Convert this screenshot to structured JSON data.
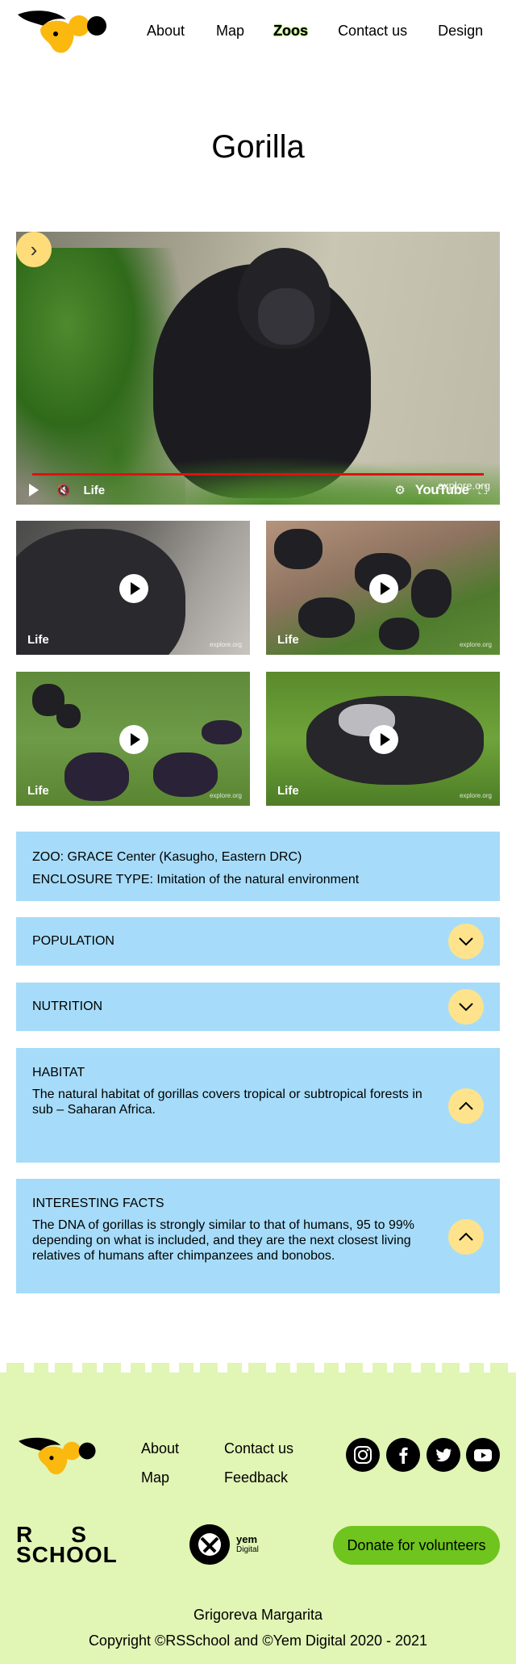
{
  "header": {
    "nav": [
      "About",
      "Map",
      "Zoos",
      "Contact us",
      "Design"
    ],
    "active_nav": "Zoos"
  },
  "page_title": "Gorilla",
  "main_video": {
    "channel_label": "Life",
    "player_brand": "YouTube",
    "watermark": "explore.org"
  },
  "thumbnails": [
    {
      "label": "Life",
      "watermark": "explore.org"
    },
    {
      "label": "Life",
      "watermark": "explore.org"
    },
    {
      "label": "Life",
      "watermark": "explore.org"
    },
    {
      "label": "Life",
      "watermark": "explore.org"
    }
  ],
  "zoo_info": {
    "zoo": "ZOO: GRACE Center (Kasugho, Eastern DRC)",
    "enclosure": "ENCLOSURE TYPE: Imitation of the natural environment"
  },
  "accordion": [
    {
      "title": "POPULATION",
      "body": "",
      "expanded": false
    },
    {
      "title": "NUTRITION",
      "body": "",
      "expanded": false
    },
    {
      "title": "HABITAT",
      "body": "The natural habitat of gorillas covers tropical or subtropical forests in sub – Saharan Africa.",
      "expanded": true
    },
    {
      "title": "INTERESTING FACTS",
      "body": "The DNA of gorillas is strongly similar to that of humans, 95 to 99% depending on what is included, and they are the next closest living relatives of humans after chimpanzees and bonobos.",
      "expanded": true
    }
  ],
  "footer": {
    "links": {
      "about": "About",
      "map": "Map",
      "contact": "Contact us",
      "feedback": "Feedback"
    },
    "social_icons": [
      "instagram-icon",
      "facebook-icon",
      "twitter-icon",
      "youtube-icon"
    ],
    "rs_line1": "RS",
    "rs_line2": "SCHOOL",
    "yem_name": "yem",
    "yem_sub": "Digital",
    "donate_label": "Donate for volunteers",
    "author": "Grigoreva Margarita",
    "copyright": "Copyright ©RSSchool and ©Yem Digital 2020 - 2021"
  },
  "colors": {
    "accent_yellow": "#fbb80f",
    "info_blue": "#a6dcf9",
    "accordion_button": "#fee38c",
    "footer_bg": "#e1f5b5",
    "donate_green": "#6fc41e",
    "progress_red": "#e01010"
  }
}
